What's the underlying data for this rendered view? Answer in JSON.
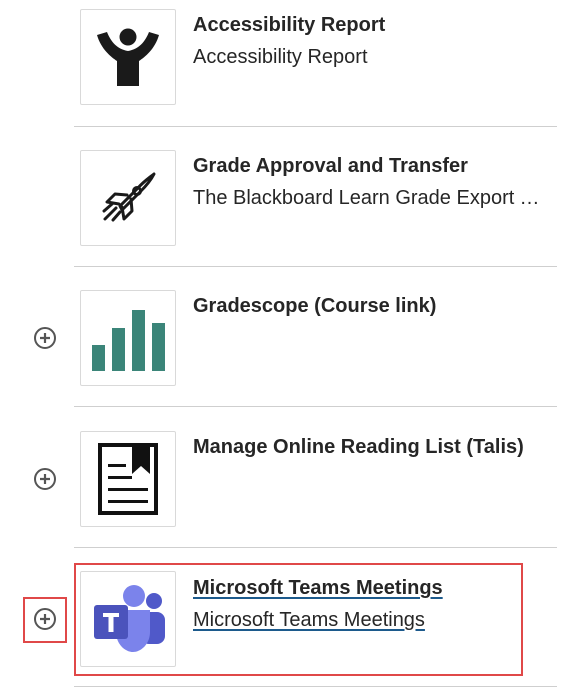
{
  "tools": [
    {
      "title": "Accessibility Report",
      "description": "Accessibility Report",
      "icon": "accessibility-person-icon",
      "has_add": false
    },
    {
      "title": "Grade Approval and Transfer",
      "description": "The Blackboard Learn Grade Export Tool",
      "icon": "rocket-icon",
      "has_add": false
    },
    {
      "title": "Gradescope (Course link)",
      "description": "",
      "icon": "gradescope-bars-icon",
      "has_add": true
    },
    {
      "title": "Manage Online Reading List (Talis)",
      "description": "",
      "icon": "reading-list-icon",
      "has_add": true
    },
    {
      "title": "Microsoft Teams Meetings",
      "description": "Microsoft Teams Meetings",
      "icon": "microsoft-teams-icon",
      "has_add": true,
      "highlighted": true
    }
  ],
  "colors": {
    "highlight": "#e04848",
    "gradescope_teal": "#3b8579",
    "teams_purple": "#5059c9",
    "text": "#262626"
  }
}
